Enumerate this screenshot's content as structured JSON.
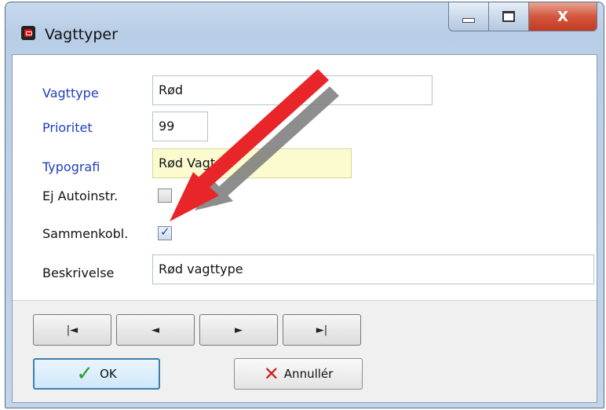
{
  "window": {
    "title": "Vagttyper",
    "icon": "app-icon"
  },
  "caption": {
    "minimize": "",
    "maximize": "",
    "close": "X"
  },
  "form": {
    "vagttype_label": "Vagttype",
    "vagttype_value": "Rød",
    "prioritet_label": "Prioritet",
    "prioritet_value": "99",
    "typografi_label": "Typografi",
    "typografi_value": "Rød Vagt",
    "ej_autoinstr_label": "Ej Autoinstr.",
    "ej_autoinstr_checked": false,
    "sammenkobl_label": "Sammenkobl.",
    "sammenkobl_checked": true,
    "beskrivelse_label": "Beskrivelse",
    "beskrivelse_value": "Rød vagttype"
  },
  "nav": {
    "first": "|◄",
    "prev": "◄",
    "next": "►",
    "last": "►|"
  },
  "buttons": {
    "ok_label": "OK",
    "cancel_label": "Annullér"
  },
  "colors": {
    "accent_label": "#1f3fbf",
    "highlight_field": "#fbfbcf",
    "annotation_arrow": "#e8262a"
  }
}
